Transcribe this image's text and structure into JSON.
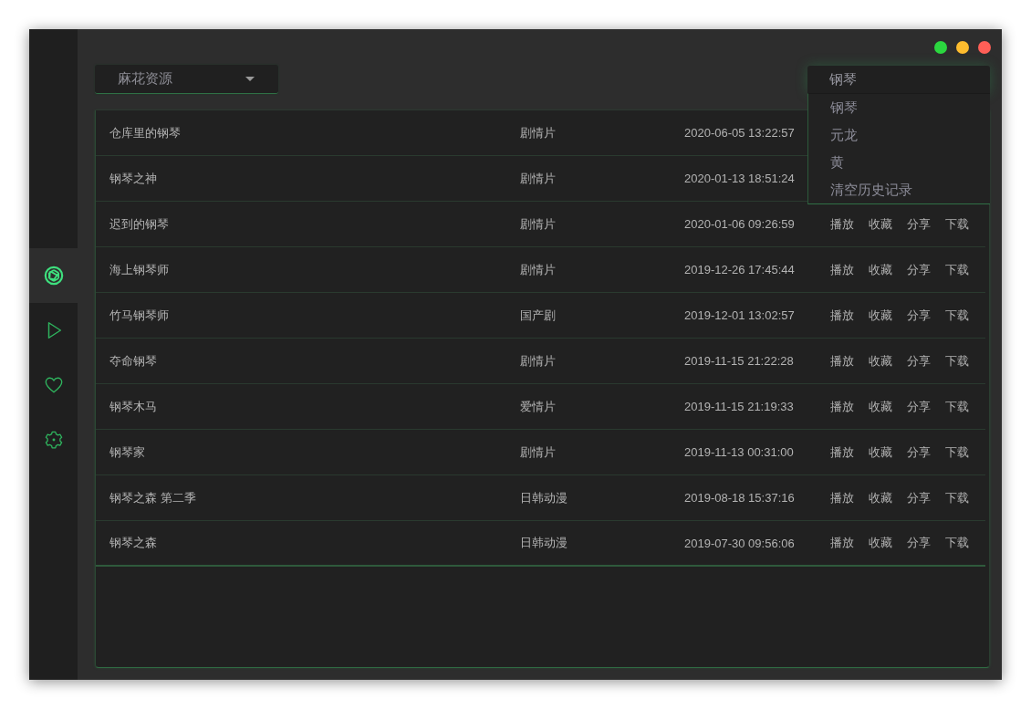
{
  "window": {
    "controls": [
      {
        "color": "#2bd63f"
      },
      {
        "color": "#fdbc2e"
      },
      {
        "color": "#fe5f57"
      }
    ]
  },
  "sidebar": {
    "items": [
      {
        "kind": "aperture",
        "selected": true
      },
      {
        "kind": "play",
        "selected": false
      },
      {
        "kind": "heart",
        "selected": false
      },
      {
        "kind": "settings",
        "selected": false
      }
    ]
  },
  "source_select": {
    "value": "麻花资源"
  },
  "search": {
    "value": "钢琴",
    "suggestions": [
      "钢琴",
      "元龙",
      "黄",
      "清空历史记录"
    ]
  },
  "table": {
    "rows": [
      {
        "title": "仓库里的钢琴",
        "genre": "剧情片",
        "time": "2020-06-05 13:22:57"
      },
      {
        "title": "钢琴之神",
        "genre": "剧情片",
        "time": "2020-01-13 18:51:24"
      },
      {
        "title": "迟到的钢琴",
        "genre": "剧情片",
        "time": "2020-01-06 09:26:59",
        "actions": [
          "播放",
          "收藏",
          "分享",
          "下载"
        ]
      },
      {
        "title": "海上钢琴师",
        "genre": "剧情片",
        "time": "2019-12-26 17:45:44",
        "actions": [
          "播放",
          "收藏",
          "分享",
          "下载"
        ]
      },
      {
        "title": "竹马钢琴师",
        "genre": "国产剧",
        "time": "2019-12-01 13:02:57",
        "actions": [
          "播放",
          "收藏",
          "分享",
          "下载"
        ]
      },
      {
        "title": "夺命钢琴",
        "genre": "剧情片",
        "time": "2019-11-15 21:22:28",
        "actions": [
          "播放",
          "收藏",
          "分享",
          "下载"
        ]
      },
      {
        "title": "钢琴木马",
        "genre": "爱情片",
        "time": "2019-11-15 21:19:33",
        "actions": [
          "播放",
          "收藏",
          "分享",
          "下载"
        ]
      },
      {
        "title": "钢琴家",
        "genre": "剧情片",
        "time": "2019-11-13 00:31:00",
        "actions": [
          "播放",
          "收藏",
          "分享",
          "下载"
        ]
      },
      {
        "title": "钢琴之森 第二季",
        "genre": "日韩动漫",
        "time": "2019-08-18 15:37:16",
        "actions": [
          "播放",
          "收藏",
          "分享",
          "下载"
        ]
      },
      {
        "title": "钢琴之森",
        "genre": "日韩动漫",
        "time": "2019-07-30 09:56:06",
        "actions": [
          "播放",
          "收藏",
          "分享",
          "下载"
        ]
      }
    ]
  }
}
